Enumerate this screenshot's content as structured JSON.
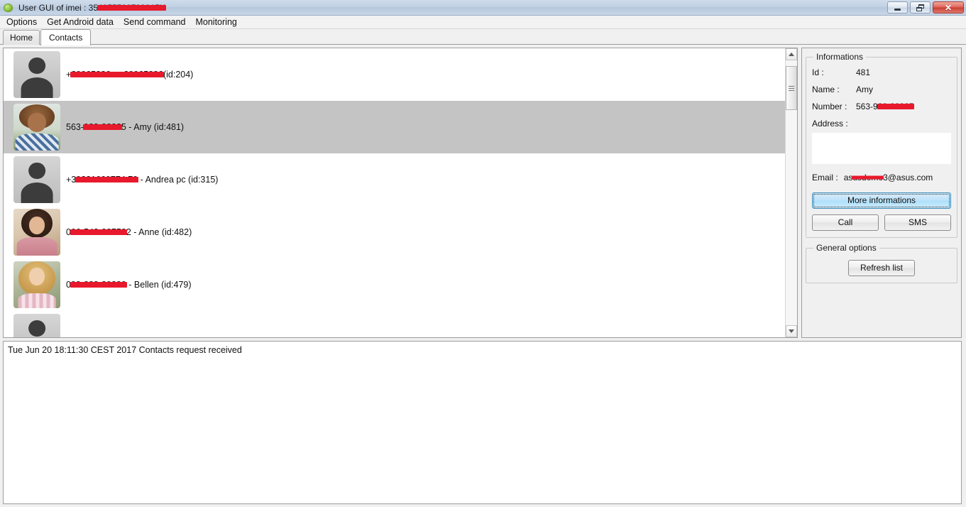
{
  "window": {
    "title_prefix": "User GUI of imei : 35",
    "title_redacted": "4955500799915X",
    "app_icon": "android-robot-icon",
    "buttons": {
      "minimize": "minimize-button",
      "restore": "restore-button",
      "close": "close-button"
    }
  },
  "menubar": {
    "items": [
      {
        "label": "Options"
      },
      {
        "label": "Get Android data"
      },
      {
        "label": "Send command"
      },
      {
        "label": "Monitoring"
      }
    ]
  },
  "tabs": [
    {
      "label": "Home",
      "active": false
    },
    {
      "label": "Contacts",
      "active": true
    }
  ],
  "contacts": [
    {
      "prefix": "+",
      "redacted": "39965886 - +39965886",
      "suffix": "(id:204)",
      "avatar": "default",
      "selected": false
    },
    {
      "prefix": "563-",
      "redacted": "988-8882",
      "suffix": "5 - Amy (id:481)",
      "avatar": "photo-curly-hair",
      "selected": true
    },
    {
      "prefix": "+3",
      "redacted": "9321669774 79",
      "suffix": " - Andrea pc (id:315)",
      "avatar": "default",
      "selected": false
    },
    {
      "prefix": "0",
      "redacted": "06-542-88758",
      "suffix": "2 - Anne (id:482)",
      "avatar": "photo-dark-hair",
      "selected": false
    },
    {
      "prefix": "0",
      "redacted": "98-888-89880",
      "suffix": " - Bellen (id:479)",
      "avatar": "photo-blonde-hair",
      "selected": false
    },
    {
      "prefix": "",
      "redacted": "",
      "suffix": "",
      "avatar": "default",
      "selected": false
    }
  ],
  "scrollbar": {
    "up_arrow": "scroll-up-arrow",
    "down_arrow": "scroll-down-arrow",
    "thumb": "scroll-thumb"
  },
  "informations": {
    "legend": "Informations",
    "id_label": "Id :",
    "id_value": "481",
    "name_label": "Name :",
    "name_value": "Amy",
    "number_label": "Number :",
    "number_prefix": "563-9",
    "number_redacted": "88-88825",
    "address_label": "Address :",
    "address_value": "",
    "email_label": "Email :",
    "email_prefix": "as",
    "email_redacted": "usdemo",
    "email_suffix": "3@asus.com",
    "more_informations_label": "More informations",
    "call_label": "Call",
    "sms_label": "SMS"
  },
  "general_options": {
    "legend": "General options",
    "refresh_label": "Refresh list"
  },
  "log": {
    "lines": [
      "Tue Jun 20 18:11:30 CEST 2017 Contacts request received"
    ]
  },
  "colors": {
    "selection": "#c4c4c4",
    "redaction": "#e8192c",
    "focus_button": "#bfe2f8",
    "close_button": "#c93d32"
  }
}
